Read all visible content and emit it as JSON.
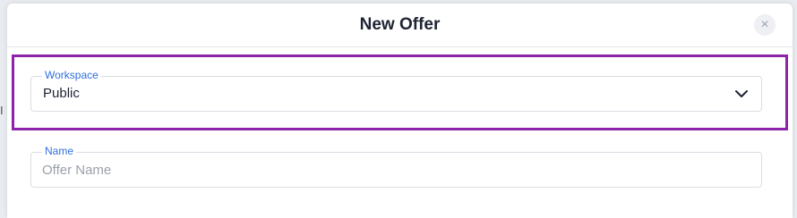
{
  "modal": {
    "title": "New Offer",
    "close_icon": "close-icon",
    "close_glyph": "×"
  },
  "backdrop": {
    "sliver_text": "I"
  },
  "form": {
    "workspace": {
      "label": "Workspace",
      "selected": "Public",
      "icon": "chevron-down-icon"
    },
    "name": {
      "label": "Name",
      "value": "",
      "placeholder": "Offer Name"
    }
  },
  "colors": {
    "highlight": "#8e24aa",
    "label_accent": "#2f6fde",
    "title_text": "#1f2433"
  }
}
